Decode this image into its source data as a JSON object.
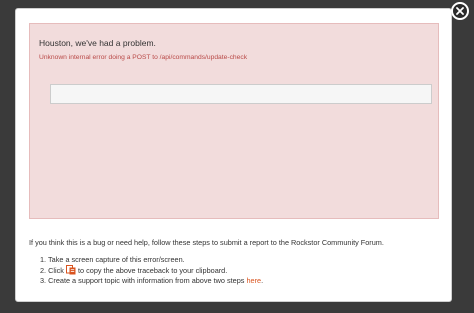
{
  "alert": {
    "title": "Houston, we've had a problem.",
    "message": "Unknown internal error doing a POST to /api/commands/update-check",
    "traceback": ""
  },
  "help": {
    "intro": "If you think this is a bug or need help, follow these steps to submit a report to the Rockstor Community Forum.",
    "step1_num": "1.",
    "step1": "Take a screen capture of this error/screen.",
    "step2_num": "2.",
    "step2_before": "Click",
    "step2_after": "to copy the above traceback to your clipboard.",
    "step3_num": "3.",
    "step3_before": "Create a support topic with information from above two steps",
    "step3_link": "here",
    "step3_after": "."
  },
  "icons": {
    "close": "close-icon",
    "clipboard": "clipboard-icon"
  },
  "colors": {
    "alert_bg": "#f2dcdc",
    "error_text": "#b94a48",
    "link": "#d9531e"
  }
}
